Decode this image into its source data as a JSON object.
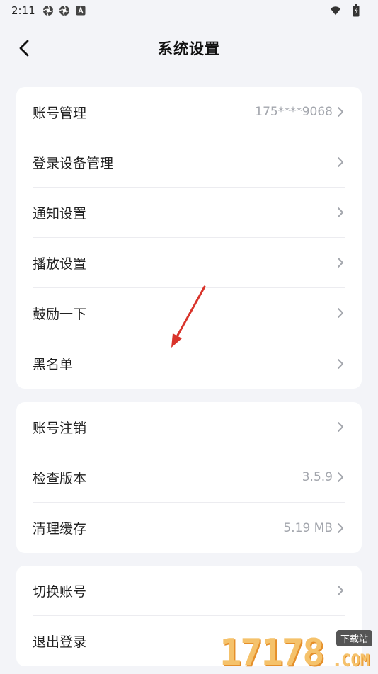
{
  "status_bar": {
    "time": "2:11",
    "left_icons": [
      "aperture-icon",
      "aperture-icon",
      "font-a-icon"
    ],
    "right_icons": [
      "wifi-icon",
      "battery-icon"
    ]
  },
  "header": {
    "title": "系统设置",
    "back_icon": "chevron-left-icon"
  },
  "group1": [
    {
      "label": "账号管理",
      "value": "175****9068"
    },
    {
      "label": "登录设备管理",
      "value": ""
    },
    {
      "label": "通知设置",
      "value": ""
    },
    {
      "label": "播放设置",
      "value": ""
    },
    {
      "label": "鼓励一下",
      "value": ""
    },
    {
      "label": "黑名单",
      "value": ""
    }
  ],
  "group2": [
    {
      "label": "账号注销",
      "value": ""
    },
    {
      "label": "检查版本",
      "value": "3.5.9"
    },
    {
      "label": "清理缓存",
      "value": "5.19 MB"
    }
  ],
  "group3": [
    {
      "label": "切换账号",
      "value": ""
    },
    {
      "label": "退出登录",
      "value": ""
    }
  ],
  "annotation_arrow_color": "#d9342b",
  "watermark": {
    "number": "17178",
    "tag": "下载站",
    "suffix": ".COM"
  }
}
